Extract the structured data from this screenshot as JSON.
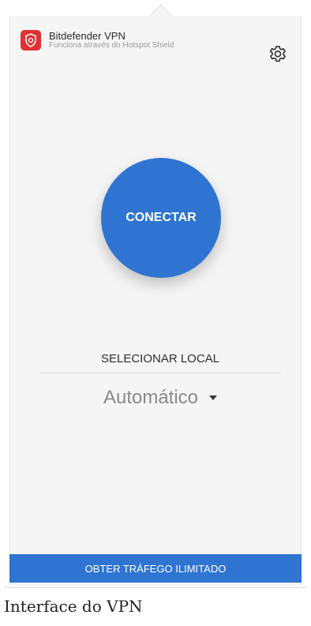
{
  "header": {
    "title": "Bitdefender VPN",
    "subtitle": "Funciona através do Hotspot Shield",
    "logo_icon": "bitdefender-shield-icon",
    "settings_icon": "gear-icon"
  },
  "main": {
    "connect_label": "CONECTAR",
    "select_location_label": "SELECIONAR LOCAL",
    "location_value": "Automático",
    "location_dropdown_icon": "caret-down-icon"
  },
  "footer": {
    "upgrade_label": "OBTER TRÁFEGO ILIMITADO"
  },
  "caption": "Interface do VPN",
  "colors": {
    "accent": "#2f74d0",
    "brand_red": "#e03235",
    "panel_bg": "#f5f5f5"
  }
}
